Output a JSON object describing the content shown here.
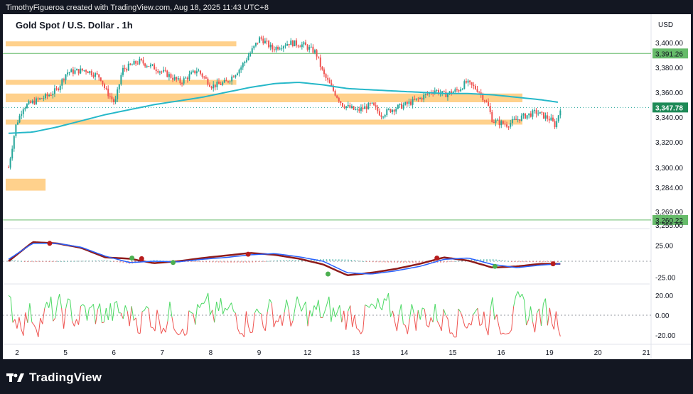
{
  "attribution": "TimothyFigueroa created with TradingView.com, Aug 18, 2025 11:43 UTC+8",
  "brand": "TradingView",
  "icons": {
    "logo": "tradingview-logo-icon"
  },
  "colors": {
    "up_candle": "#26a69a",
    "down_candle": "#ef5350",
    "ma_line": "#26b8c9",
    "zone_fill": "#ffcc80",
    "hline": "#66bb6a",
    "price_badge": "#1e8a57",
    "macd_line": "#2962ff",
    "signal_line": "#8e1b1b",
    "signal_up": "#4caf50",
    "osc_up": "#4cd964",
    "osc_down": "#ef5350"
  },
  "chart_data": {
    "type": "candlestick",
    "title": "Gold Spot / U.S. Dollar . 1h",
    "currency": "USD",
    "x_tick_labels": [
      "2",
      "5",
      "6",
      "7",
      "8",
      "9",
      "12",
      "13",
      "14",
      "15",
      "16",
      "19",
      "20",
      "21"
    ],
    "y_ticks": [
      3400.0,
      3380.0,
      3360.0,
      3340.0,
      3320.0,
      3300.0,
      3284.0,
      3269.0,
      3255.0
    ],
    "y_tick_labels": [
      "3,400.00",
      "3,380.00",
      "3,360.00",
      "3,340.00",
      "3,320.00",
      "3,300.00",
      "3,284.00",
      "3,269.00",
      "3,255.00"
    ],
    "horizontal_lines": [
      {
        "value": 3391.26,
        "label": "3,391.26"
      },
      {
        "value": 3260.22,
        "label": "3,260.22"
      }
    ],
    "current_price": {
      "value": 3347.78,
      "label": "3,347.78"
    },
    "zones": [
      {
        "start_day": "2",
        "end_day": "9",
        "low": 3397,
        "high": 3401
      },
      {
        "start_day": "2",
        "end_day": "9",
        "low": 3366,
        "high": 3370
      },
      {
        "start_day": "2",
        "end_day": "16",
        "low": 3352,
        "high": 3359
      },
      {
        "start_day": "2",
        "end_day": "16",
        "low": 3334,
        "high": 3338
      },
      {
        "start_day": "2",
        "end_day": "5",
        "low": 3282,
        "high": 3291
      }
    ],
    "price_anchors": [
      {
        "x": 0.0,
        "p": 3300
      },
      {
        "x": 0.15,
        "p": 3333
      },
      {
        "x": 0.3,
        "p": 3348
      },
      {
        "x": 0.5,
        "p": 3352
      },
      {
        "x": 0.8,
        "p": 3357
      },
      {
        "x": 1.0,
        "p": 3362
      },
      {
        "x": 1.2,
        "p": 3376
      },
      {
        "x": 1.6,
        "p": 3378
      },
      {
        "x": 1.9,
        "p": 3372
      },
      {
        "x": 2.0,
        "p": 3362
      },
      {
        "x": 2.2,
        "p": 3351
      },
      {
        "x": 2.35,
        "p": 3378
      },
      {
        "x": 2.7,
        "p": 3385
      },
      {
        "x": 3.0,
        "p": 3380
      },
      {
        "x": 3.3,
        "p": 3374
      },
      {
        "x": 3.55,
        "p": 3368
      },
      {
        "x": 3.9,
        "p": 3378
      },
      {
        "x": 4.2,
        "p": 3365
      },
      {
        "x": 4.5,
        "p": 3368
      },
      {
        "x": 4.8,
        "p": 3380
      },
      {
        "x": 5.0,
        "p": 3392
      },
      {
        "x": 5.2,
        "p": 3404
      },
      {
        "x": 5.45,
        "p": 3395
      },
      {
        "x": 5.8,
        "p": 3400
      },
      {
        "x": 6.1,
        "p": 3398
      },
      {
        "x": 6.35,
        "p": 3392
      },
      {
        "x": 6.5,
        "p": 3375
      },
      {
        "x": 6.7,
        "p": 3362
      },
      {
        "x": 6.9,
        "p": 3350
      },
      {
        "x": 7.2,
        "p": 3345
      },
      {
        "x": 7.5,
        "p": 3350
      },
      {
        "x": 7.7,
        "p": 3342
      },
      {
        "x": 7.9,
        "p": 3346
      },
      {
        "x": 8.2,
        "p": 3350
      },
      {
        "x": 8.5,
        "p": 3355
      },
      {
        "x": 8.8,
        "p": 3362
      },
      {
        "x": 9.0,
        "p": 3358
      },
      {
        "x": 9.3,
        "p": 3362
      },
      {
        "x": 9.45,
        "p": 3368
      },
      {
        "x": 9.7,
        "p": 3362
      },
      {
        "x": 9.9,
        "p": 3350
      },
      {
        "x": 10.0,
        "p": 3337
      },
      {
        "x": 10.3,
        "p": 3334
      },
      {
        "x": 10.6,
        "p": 3340
      },
      {
        "x": 10.9,
        "p": 3344
      },
      {
        "x": 11.2,
        "p": 3338
      },
      {
        "x": 11.3,
        "p": 3333
      },
      {
        "x": 11.4,
        "p": 3347.78
      }
    ],
    "ma_anchors": [
      {
        "x": 0.0,
        "p": 3327
      },
      {
        "x": 0.5,
        "p": 3328
      },
      {
        "x": 1.0,
        "p": 3332
      },
      {
        "x": 1.5,
        "p": 3337
      },
      {
        "x": 2.0,
        "p": 3342
      },
      {
        "x": 2.5,
        "p": 3346
      },
      {
        "x": 3.0,
        "p": 3350
      },
      {
        "x": 3.5,
        "p": 3353
      },
      {
        "x": 4.0,
        "p": 3356
      },
      {
        "x": 4.5,
        "p": 3360
      },
      {
        "x": 5.0,
        "p": 3364
      },
      {
        "x": 5.5,
        "p": 3367
      },
      {
        "x": 6.0,
        "p": 3368
      },
      {
        "x": 6.5,
        "p": 3366
      },
      {
        "x": 7.0,
        "p": 3363
      },
      {
        "x": 7.5,
        "p": 3362
      },
      {
        "x": 8.0,
        "p": 3361
      },
      {
        "x": 8.5,
        "p": 3360
      },
      {
        "x": 9.0,
        "p": 3359
      },
      {
        "x": 9.5,
        "p": 3359
      },
      {
        "x": 10.0,
        "p": 3358
      },
      {
        "x": 10.5,
        "p": 3356
      },
      {
        "x": 11.0,
        "p": 3354
      },
      {
        "x": 11.35,
        "p": 3352
      }
    ],
    "macd": {
      "y_ticks": [
        25.0,
        -25.0
      ],
      "y_tick_labels": [
        "25.00",
        "-25.00"
      ],
      "macd_anchors": [
        {
          "x": 0.0,
          "v": 3
        },
        {
          "x": 0.5,
          "v": 28
        },
        {
          "x": 1.0,
          "v": 28
        },
        {
          "x": 1.5,
          "v": 22
        },
        {
          "x": 2.0,
          "v": 8
        },
        {
          "x": 2.5,
          "v": -2
        },
        {
          "x": 3.0,
          "v": 0
        },
        {
          "x": 3.5,
          "v": -1
        },
        {
          "x": 4.0,
          "v": 3
        },
        {
          "x": 4.5,
          "v": 6
        },
        {
          "x": 5.0,
          "v": 10
        },
        {
          "x": 5.5,
          "v": 12
        },
        {
          "x": 6.0,
          "v": 7
        },
        {
          "x": 6.5,
          "v": 0
        },
        {
          "x": 7.0,
          "v": -18
        },
        {
          "x": 7.5,
          "v": -20
        },
        {
          "x": 8.0,
          "v": -15
        },
        {
          "x": 8.5,
          "v": -8
        },
        {
          "x": 9.0,
          "v": 3
        },
        {
          "x": 9.5,
          "v": 5
        },
        {
          "x": 10.0,
          "v": -5
        },
        {
          "x": 10.5,
          "v": -10
        },
        {
          "x": 11.0,
          "v": -6
        },
        {
          "x": 11.4,
          "v": -4
        }
      ],
      "signal_anchors": [
        {
          "x": 0.0,
          "v": 0
        },
        {
          "x": 0.5,
          "v": 30
        },
        {
          "x": 1.0,
          "v": 28
        },
        {
          "x": 1.5,
          "v": 21
        },
        {
          "x": 2.0,
          "v": 6
        },
        {
          "x": 2.5,
          "v": 4
        },
        {
          "x": 3.0,
          "v": -3
        },
        {
          "x": 3.5,
          "v": 0
        },
        {
          "x": 4.0,
          "v": 5
        },
        {
          "x": 4.5,
          "v": 9
        },
        {
          "x": 5.0,
          "v": 13
        },
        {
          "x": 5.5,
          "v": 10
        },
        {
          "x": 6.0,
          "v": 4
        },
        {
          "x": 6.5,
          "v": -5
        },
        {
          "x": 7.0,
          "v": -22
        },
        {
          "x": 7.5,
          "v": -18
        },
        {
          "x": 8.0,
          "v": -12
        },
        {
          "x": 8.5,
          "v": -4
        },
        {
          "x": 9.0,
          "v": 6
        },
        {
          "x": 9.5,
          "v": 1
        },
        {
          "x": 10.0,
          "v": -10
        },
        {
          "x": 10.5,
          "v": -8
        },
        {
          "x": 11.0,
          "v": -4
        },
        {
          "x": 11.4,
          "v": -4
        }
      ],
      "cross_markers": [
        {
          "x": 0.85,
          "v": 28,
          "type": "down"
        },
        {
          "x": 2.55,
          "v": 5,
          "type": "up"
        },
        {
          "x": 2.75,
          "v": 4,
          "type": "down"
        },
        {
          "x": 3.4,
          "v": -2,
          "type": "up"
        },
        {
          "x": 4.95,
          "v": 11,
          "type": "down"
        },
        {
          "x": 6.6,
          "v": -20,
          "type": "up"
        },
        {
          "x": 8.85,
          "v": 5,
          "type": "down"
        },
        {
          "x": 10.05,
          "v": -8,
          "type": "up"
        },
        {
          "x": 11.25,
          "v": -4,
          "type": "down"
        }
      ]
    },
    "oscillator": {
      "y_ticks": [
        20.0,
        0.0,
        -20.0
      ],
      "y_tick_labels": [
        "20.00",
        "0.00",
        "-20.00"
      ]
    }
  }
}
